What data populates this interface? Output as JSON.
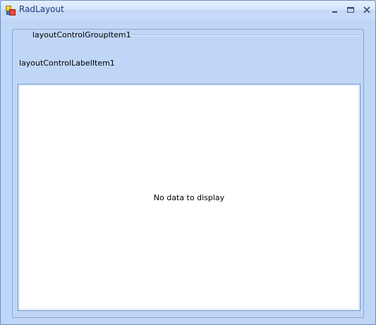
{
  "window": {
    "title": "RadLayout"
  },
  "title_controls": {
    "minimize_icon": "minimize-icon",
    "maximize_icon": "maximize-icon",
    "close_icon": "close-icon"
  },
  "layout": {
    "group_title": "layoutControlGroupItem1",
    "label_item": "layoutControlLabelItem1"
  },
  "grid": {
    "empty_text": "No data to display"
  },
  "colors": {
    "title_text": "#1c3d7a",
    "client_background": "#bfd6f7",
    "grid_border": "#6c8fc4",
    "grid_background": "#ffffff"
  }
}
